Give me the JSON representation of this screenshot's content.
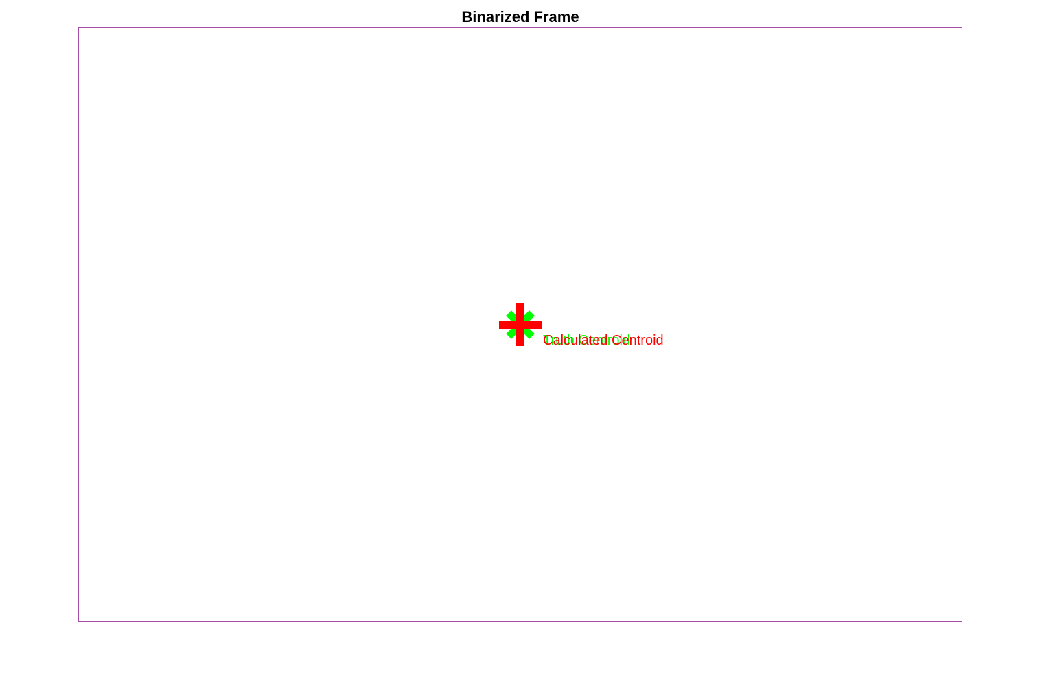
{
  "chart_data": {
    "type": "scatter",
    "title": "Binarized Frame",
    "xlabel": "",
    "ylabel": "",
    "grid": false,
    "axes_visible": false,
    "frame_color": "#a64ca6",
    "background": "#ffffff",
    "series": [
      {
        "marker": "asterisk",
        "color": "#00ff00",
        "points": [
          {
            "x": 0.5,
            "y": 0.5
          }
        ],
        "annotations": [
          {
            "text": "Truth Centroid"
          }
        ]
      },
      {
        "marker": "plus",
        "color": "#ff0000",
        "points": [
          {
            "x": 0.5,
            "y": 0.5
          }
        ],
        "annotations": [
          {
            "text": "Calculated Centroid"
          }
        ]
      }
    ]
  }
}
